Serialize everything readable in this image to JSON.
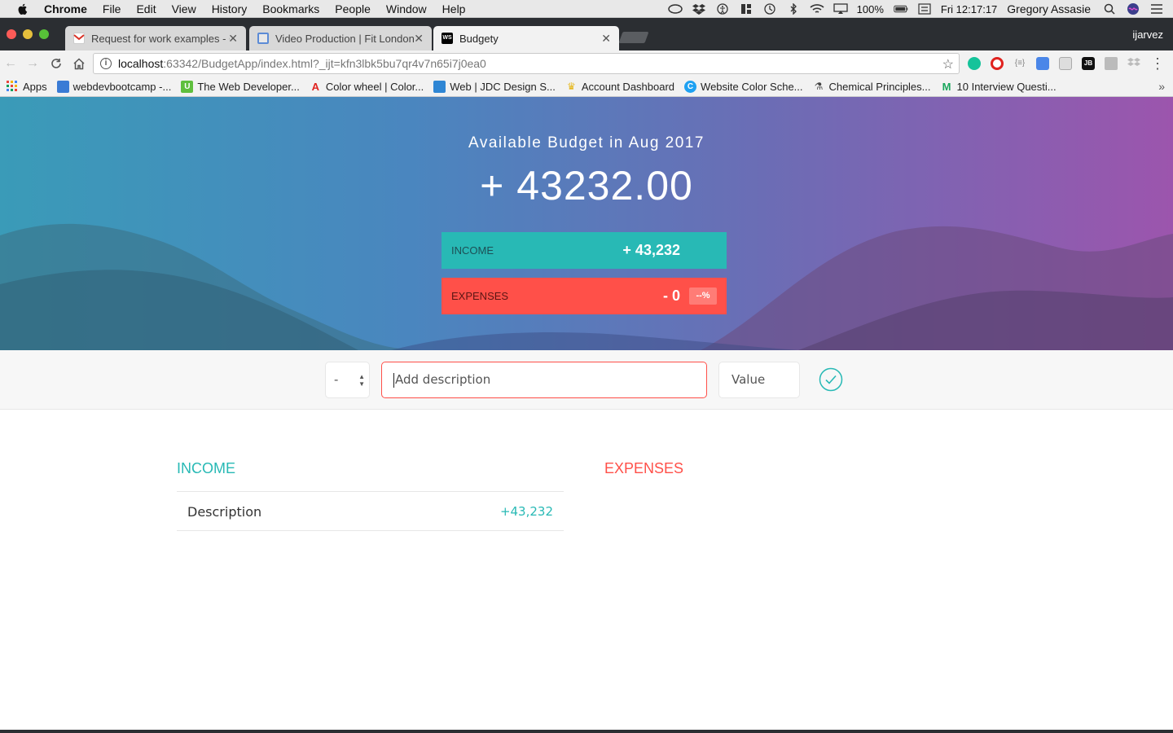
{
  "os_menubar": {
    "app": "Chrome",
    "menus": [
      "File",
      "Edit",
      "View",
      "History",
      "Bookmarks",
      "People",
      "Window",
      "Help"
    ],
    "battery": "100%",
    "clock": "Fri 12:17:17",
    "user": "Gregory Assasie"
  },
  "browser": {
    "tabs": [
      {
        "label": "Request for work examples - G",
        "icon": "gmail-icon"
      },
      {
        "label": "Video Production | Fit London",
        "icon": "site-icon"
      },
      {
        "label": "Budgety",
        "icon": "webstorm-icon"
      }
    ],
    "profile": "ijarvez",
    "url_host": "localhost",
    "url_path": ":63342/BudgetApp/index.html?_ijt=kfn3lbk5bu7qr4v7n65i7j0ea0",
    "bookmarks": [
      "Apps",
      "webdevbootcamp -...",
      "The Web Developer...",
      "Color wheel | Color...",
      "Web | JDC Design S...",
      "Account Dashboard",
      "Website Color Sche...",
      "Chemical Principles...",
      "10 Interview Questi..."
    ],
    "colors": {
      "tabstrip": "#2b2e32",
      "toolbar": "#f2f2f2"
    }
  },
  "budget": {
    "title": "Available Budget in Aug 2017",
    "value": "+ 43232.00",
    "income_label": "INCOME",
    "income_value": "+ 43,232",
    "expenses_label": "EXPENSES",
    "expenses_value": "- 0",
    "expenses_percentage": "--%"
  },
  "add_form": {
    "type_value": "-",
    "description_placeholder": "Add description",
    "value_placeholder": "Value"
  },
  "lists": {
    "income_title": "INCOME",
    "expenses_title": "EXPENSES",
    "income_items": [
      {
        "description": "Description",
        "value": "+43,232"
      }
    ]
  },
  "colors": {
    "income": "#28b9b5",
    "expenses": "#ff5049"
  }
}
